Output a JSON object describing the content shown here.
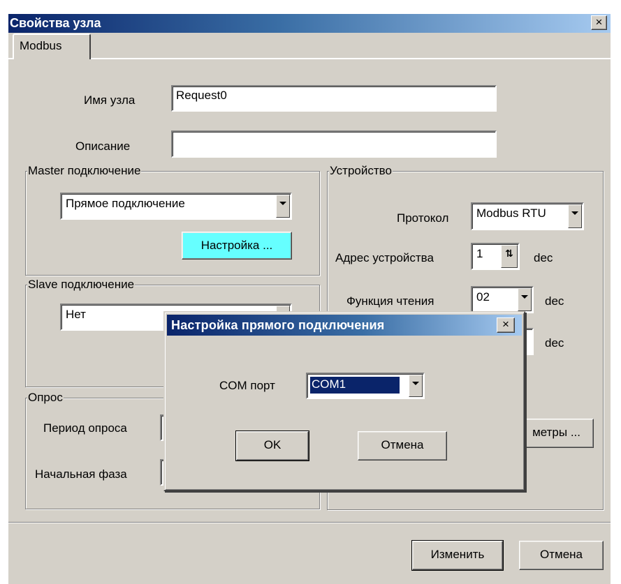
{
  "main_dialog": {
    "title": "Свойства узла",
    "close_glyph": "×",
    "tab_label": "Modbus",
    "node_name_label": "Имя узла",
    "node_name_value": "Request0",
    "description_label": "Описание",
    "description_value": "",
    "master": {
      "legend": "Master подключение",
      "connection_value": "Прямое подключение",
      "settings_button": "Настройка ..."
    },
    "slave": {
      "legend": "Slave подключение",
      "connection_value": "Нет"
    },
    "poll": {
      "legend": "Опрос",
      "period_label": "Период опроса",
      "phase_label": "Начальная фаза"
    },
    "device": {
      "legend": "Устройство",
      "protocol_label": "Протокол",
      "protocol_value": "Modbus RTU",
      "address_label": "Адрес устройства",
      "address_value": "1",
      "address_unit": "dec",
      "read_func_label": "Функция чтения",
      "read_func_value": "02",
      "read_func_unit": "dec",
      "hidden_row_unit": "dec",
      "params_button_partial": "метры ..."
    },
    "buttons": {
      "apply": "Изменить",
      "cancel": "Отмена"
    }
  },
  "popup": {
    "title": "Настройка прямого подключения",
    "close_glyph": "×",
    "com_label": "COM порт",
    "com_value": "COM1",
    "ok": "OK",
    "cancel": "Отмена"
  },
  "colors": {
    "title_gradient_start": "#0a246a",
    "title_gradient_end": "#a6caf0",
    "face": "#d4d0c8",
    "settings_button_bg": "#66ffff",
    "selected_combo_bg": "#0a246a"
  }
}
